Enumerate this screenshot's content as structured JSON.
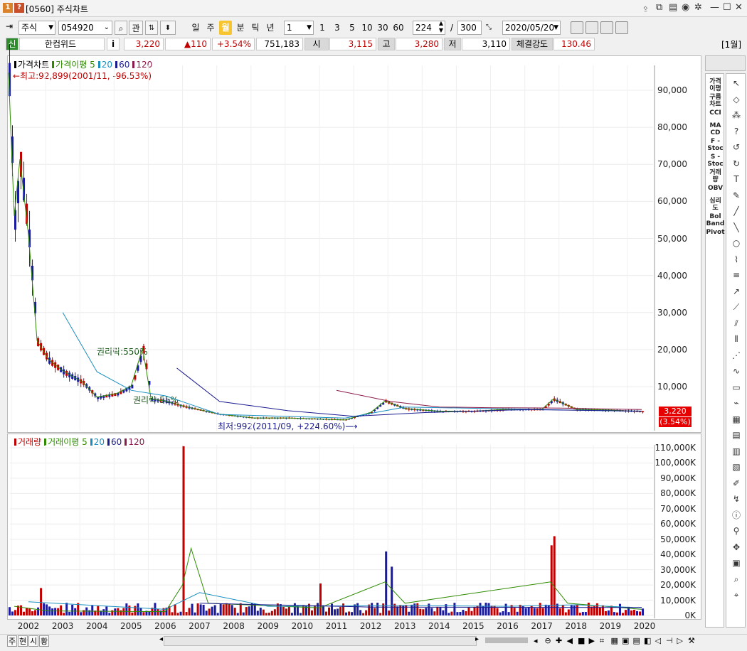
{
  "window": {
    "badge1": "1",
    "badge2": "?",
    "title": "[0560] 주식차트"
  },
  "toolbar": {
    "market_select": "주식",
    "code_input": "054920",
    "btn_gwan": "관",
    "periods": [
      "일",
      "주",
      "월",
      "분",
      "틱",
      "년"
    ],
    "active_period": "월",
    "interval_select": "1",
    "interval_buttons": [
      "1",
      "3",
      "5",
      "10",
      "30",
      "60"
    ],
    "count_value": "224",
    "count_sep": "/",
    "count_total": "300",
    "date_value": "2020/05/20"
  },
  "quote": {
    "badge": "신",
    "name": "한컴위드",
    "info_btn": "i",
    "price": "3,220",
    "change": "▲110",
    "change_pct": "+3.54%",
    "volume": "751,183",
    "open_lbl": "시",
    "open": "3,115",
    "high_lbl": "고",
    "high": "3,280",
    "low_lbl": "저",
    "low": "3,110",
    "strength_lbl": "체결강도",
    "strength": "130.46",
    "period_tag": "[1월]"
  },
  "price_pane": {
    "legend": [
      {
        "label": "가격차트",
        "color": "#000000"
      },
      {
        "label": "가격이평 5",
        "color": "#2e8b00"
      },
      {
        "label": "20",
        "color": "#1a8fbf"
      },
      {
        "label": "60",
        "color": "#1a1a8f"
      },
      {
        "label": "120",
        "color": "#8b1a4a"
      }
    ],
    "max_note": "←최고:92,899(2001/11, -96.53%)",
    "min_note": "최저:992(2011/09, +224.60%)⟶",
    "rights_note1": "권리락:550%",
    "rights_note2": "권리락:55%",
    "last_price_tag": "3,220",
    "last_pct_tag": "(3.54%)",
    "y_ticks": [
      "90,000",
      "80,000",
      "70,000",
      "60,000",
      "50,000",
      "40,000",
      "30,000",
      "20,000",
      "10,000"
    ]
  },
  "volume_pane": {
    "legend": [
      {
        "label": "거래량",
        "color": "#c00000"
      },
      {
        "label": "거래이평 5",
        "color": "#2e8b00"
      },
      {
        "label": "20",
        "color": "#1a8fbf"
      },
      {
        "label": "60",
        "color": "#1a1a8f"
      },
      {
        "label": "120",
        "color": "#8b1a4a"
      }
    ],
    "y_ticks": [
      "110,000K",
      "100,000K",
      "90,000K",
      "80,000K",
      "70,000K",
      "60,000K",
      "50,000K",
      "40,000K",
      "30,000K",
      "20,000K",
      "10,000K",
      "0K"
    ]
  },
  "x_axis": {
    "years": [
      "2002",
      "2003",
      "2004",
      "2005",
      "2006",
      "2007",
      "2008",
      "2009",
      "2010",
      "2011",
      "2012",
      "2013",
      "2014",
      "2015",
      "2016",
      "2017",
      "2018",
      "2019",
      "2020"
    ]
  },
  "indicators": [
    {
      "label": "가격\n이평"
    },
    {
      "label": "구름\n차트"
    },
    {
      "label": "CCI"
    },
    {
      "label": "MA\nCD"
    },
    {
      "label": "F -\nStoc"
    },
    {
      "label": "S -\nStoc"
    },
    {
      "label": "거래\n량"
    },
    {
      "label": "OBV"
    },
    {
      "label": "심리\n도"
    },
    {
      "label": "Bol\nBand"
    },
    {
      "label": "Pivot"
    }
  ],
  "bottom": {
    "tabs": [
      "주",
      "현",
      "시",
      "황"
    ]
  },
  "colors": {
    "up": "#c00000",
    "down": "#1a1aa0",
    "ma5": "#2e8b00",
    "ma20": "#1a8fbf",
    "ma60": "#1a1a8f",
    "ma120": "#8b1a4a",
    "active_period": "#f7c52f"
  },
  "chart_data": [
    {
      "type": "candlestick",
      "title": "가격차트",
      "x_range": [
        "2001/11",
        "2020/05"
      ],
      "ylim": [
        0,
        95000
      ],
      "y_ticks": [
        10000,
        20000,
        30000,
        40000,
        50000,
        60000,
        70000,
        80000,
        90000
      ],
      "series": [
        {
          "name": "가격차트",
          "points": [
            [
              "2001/11",
              92899
            ],
            [
              "2002/01",
              55000
            ],
            [
              "2002/03",
              70000
            ],
            [
              "2002/06",
              50000
            ],
            [
              "2002/09",
              22000
            ],
            [
              "2003/01",
              17000
            ],
            [
              "2003/06",
              14000
            ],
            [
              "2004/01",
              11000
            ],
            [
              "2004/06",
              7000
            ],
            [
              "2005/01",
              8000
            ],
            [
              "2005/06",
              10000
            ],
            [
              "2005/10",
              20000
            ],
            [
              "2006/01",
              6500
            ],
            [
              "2006/06",
              6000
            ],
            [
              "2007/01",
              4500
            ],
            [
              "2008/01",
              2500
            ],
            [
              "2009/01",
              1500
            ],
            [
              "2010/01",
              1500
            ],
            [
              "2011/09",
              992
            ],
            [
              "2012/06",
              3000
            ],
            [
              "2012/11",
              6000
            ],
            [
              "2013/06",
              4000
            ],
            [
              "2014/06",
              3300
            ],
            [
              "2015/06",
              3300
            ],
            [
              "2016/06",
              3800
            ],
            [
              "2017/06",
              3800
            ],
            [
              "2017/10",
              6500
            ],
            [
              "2018/06",
              3800
            ],
            [
              "2019/06",
              3600
            ],
            [
              "2020/05",
              3220
            ]
          ]
        },
        {
          "name": "60",
          "points": [
            [
              "2006/10",
              15000
            ],
            [
              "2008/01",
              6000
            ],
            [
              "2010/01",
              3500
            ],
            [
              "2011/12",
              2000
            ],
            [
              "2014/01",
              3000
            ],
            [
              "2017/01",
              3800
            ],
            [
              "2020/05",
              3400
            ]
          ]
        },
        {
          "name": "120",
          "points": [
            [
              "2011/06",
              9000
            ],
            [
              "2013/01",
              6000
            ],
            [
              "2014/06",
              4500
            ],
            [
              "2016/01",
              4300
            ],
            [
              "2018/01",
              4200
            ],
            [
              "2020/05",
              3800
            ]
          ]
        }
      ],
      "annotations": [
        "←최고:92,899(2001/11, -96.53%)",
        "최저:992(2011/09, +224.60%)⟶",
        "권리락:550%",
        "권리락:55%"
      ]
    },
    {
      "type": "bar",
      "title": "거래량",
      "unit": "K",
      "ylim": [
        0,
        115000
      ],
      "y_ticks": [
        0,
        10000,
        20000,
        30000,
        40000,
        50000,
        60000,
        70000,
        80000,
        90000,
        100000,
        110000
      ],
      "peaks": [
        {
          "x": "2002/10",
          "value": 18000
        },
        {
          "x": "2006/12",
          "value": 111000
        },
        {
          "x": "2010/12",
          "value": 21000
        },
        {
          "x": "2012/11",
          "value": 42000
        },
        {
          "x": "2013/01",
          "value": 32000
        },
        {
          "x": "2017/10",
          "value": 52000
        },
        {
          "x": "2017/09",
          "value": 46000
        }
      ]
    }
  ]
}
